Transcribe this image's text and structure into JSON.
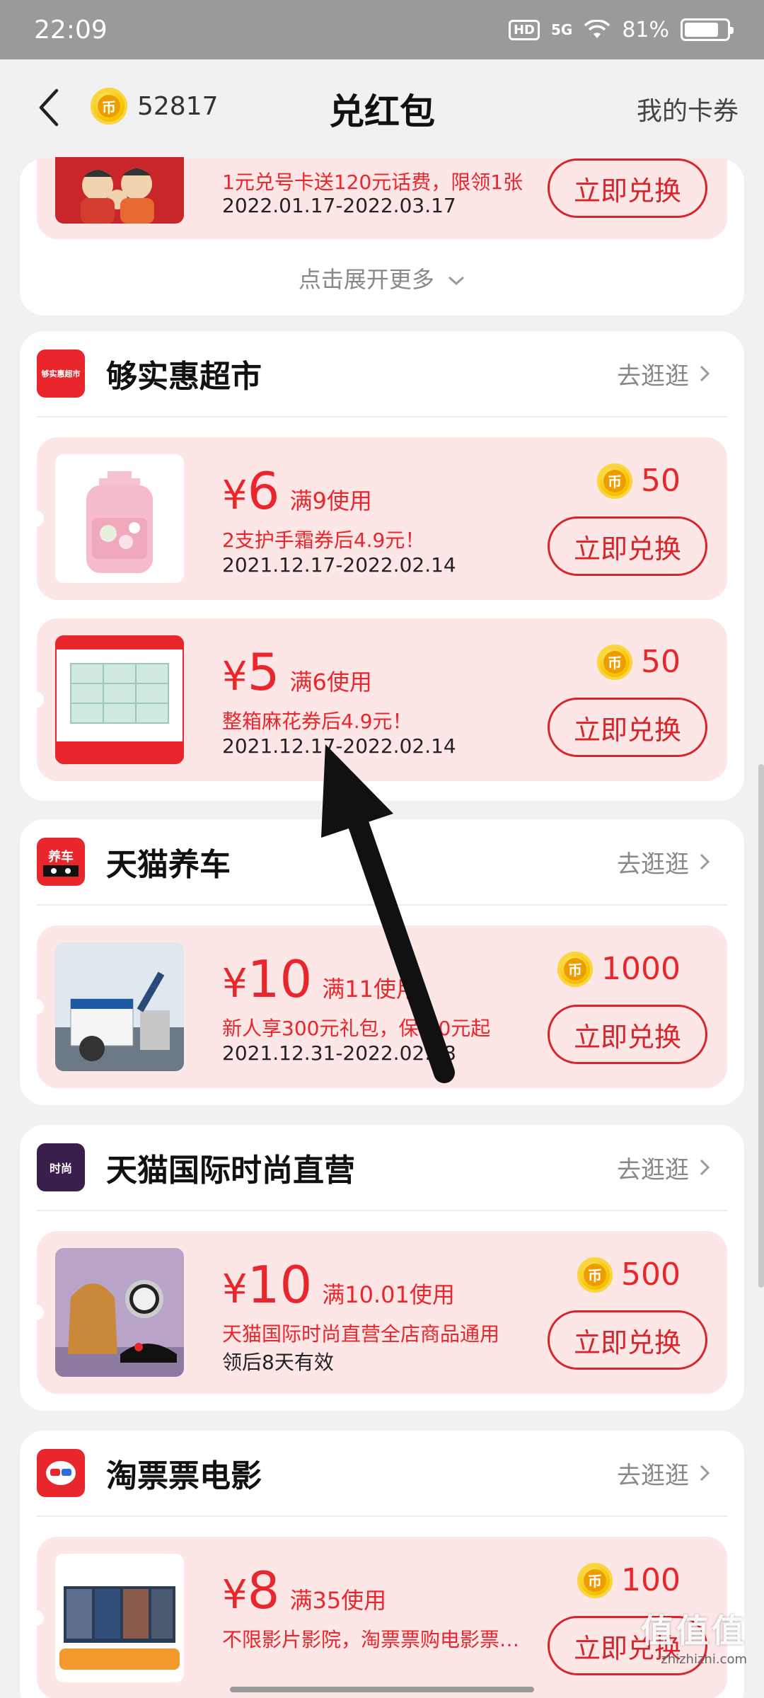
{
  "status_bar": {
    "time": "22:09",
    "hd": "HD",
    "network": "5G",
    "battery": "81%",
    "battery_level": 0.81
  },
  "header": {
    "coin_balance": "52817",
    "title": "兑红包",
    "my_coupons": "我的卡券"
  },
  "colors": {
    "accent_red": "#e8262c",
    "coupon_bg": "#fde6e6",
    "coin_gold": "#f5c100"
  },
  "top_section": {
    "coupon": {
      "desc": "1元兑号卡送120元话费，限领1张",
      "date": "2022.01.17-2022.03.17",
      "button": "立即兑换"
    },
    "expand_more": "点击展开更多"
  },
  "stores": [
    {
      "name": "够实惠超市",
      "logo_text": "够实惠超市",
      "go_shop": "去逛逛",
      "coupons": [
        {
          "yen": "¥",
          "amount": "6",
          "condition": "满9使用",
          "desc": "2支护手霜券后4.9元！",
          "date": "2021.12.17-2022.02.14",
          "price": "50",
          "button": "立即兑换",
          "image": "laundry-detergent-bottle"
        },
        {
          "yen": "¥",
          "amount": "5",
          "condition": "满6使用",
          "desc": "整箱麻花券后4.9元！",
          "date": "2021.12.17-2022.02.14",
          "price": "50",
          "button": "立即兑换",
          "image": "tissue-box-pack"
        }
      ]
    },
    {
      "name": "天猫养车",
      "logo_text": "养车",
      "go_shop": "去逛逛",
      "coupons": [
        {
          "yen": "¥",
          "amount": "10",
          "condition": "满11使用",
          "desc": "新人享300元礼包，保养0元起",
          "date": "2021.12.31-2022.02.28",
          "price": "1000",
          "button": "立即兑换",
          "image": "car-battery-parts"
        }
      ]
    },
    {
      "name": "天猫国际时尚直营",
      "logo_text": "时尚",
      "go_shop": "去逛逛",
      "coupons": [
        {
          "yen": "¥",
          "amount": "10",
          "condition": "满10.01使用",
          "desc": "天猫国际时尚直营全店商品通用",
          "date": "领后8天有效",
          "price": "500",
          "button": "立即兑换",
          "image": "backpack-watch-sneaker"
        }
      ]
    },
    {
      "name": "淘票票电影",
      "logo_text": "",
      "go_shop": "去逛逛",
      "coupons": [
        {
          "yen": "¥",
          "amount": "8",
          "condition": "满35使用",
          "desc": "不限影片影院，淘票票购电影票…",
          "date": "",
          "price": "100",
          "button": "立即兑换",
          "image": "movie-posters"
        }
      ]
    }
  ],
  "watermark": {
    "big": "值值值",
    "small": "zhizhizhi.com"
  }
}
